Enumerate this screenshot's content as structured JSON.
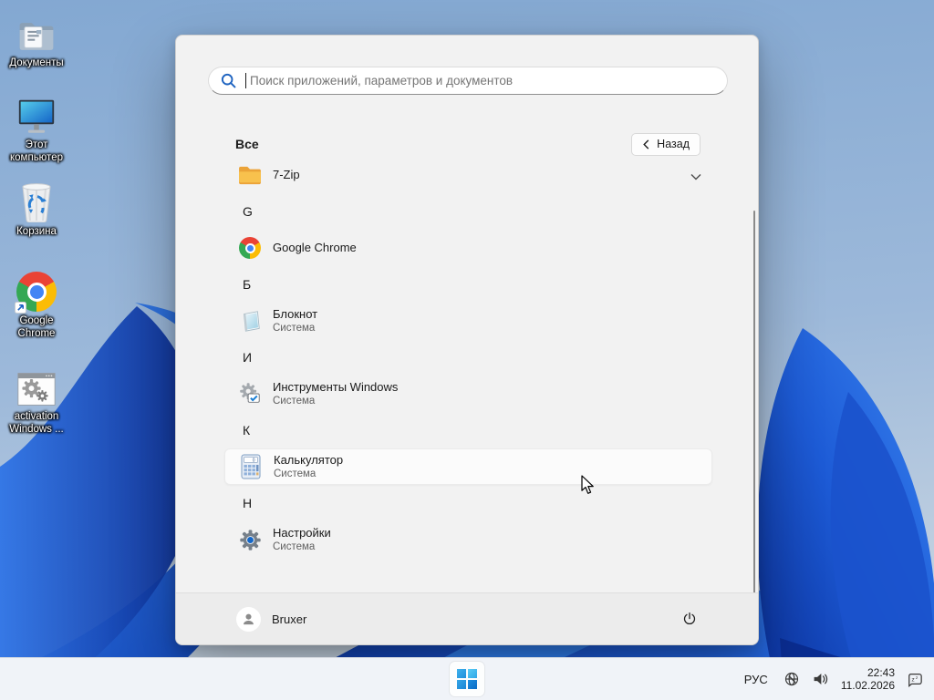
{
  "desktop": {
    "icons": [
      {
        "name": "documents",
        "label": "Документы"
      },
      {
        "name": "this-pc",
        "label": "Этот компьютер"
      },
      {
        "name": "recycle-bin",
        "label": "Корзина"
      },
      {
        "name": "google-chrome",
        "label": "Google Chrome"
      },
      {
        "name": "activation-windows",
        "label": "activation Windows ..."
      }
    ]
  },
  "start_menu": {
    "search": {
      "placeholder": "Поиск приложений, параметров и документов"
    },
    "header": {
      "title": "Все",
      "back_label": "Назад"
    },
    "rows": [
      {
        "type": "app",
        "label": "7-Zip",
        "expandable": true
      },
      {
        "type": "section",
        "label": "G"
      },
      {
        "type": "app",
        "label": "Google Chrome"
      },
      {
        "type": "section",
        "label": "Б"
      },
      {
        "type": "app",
        "label": "Блокнот",
        "sublabel": "Система"
      },
      {
        "type": "section",
        "label": "И"
      },
      {
        "type": "app",
        "label": "Инструменты Windows",
        "sublabel": "Система"
      },
      {
        "type": "section",
        "label": "К"
      },
      {
        "type": "app",
        "label": "Калькулятор",
        "sublabel": "Система",
        "highlighted": true
      },
      {
        "type": "section",
        "label": "Н"
      },
      {
        "type": "app",
        "label": "Настройки",
        "sublabel": "Система"
      }
    ],
    "footer": {
      "user_name": "Bruxer"
    }
  },
  "taskbar": {
    "language_indicator": "РУС",
    "clock": {
      "time": "22:43",
      "date": "11.02.2026"
    }
  },
  "icons": {
    "search-icon": "magnifying glass, blue",
    "back-chevron-icon": "‹",
    "chevron-down-icon": "⌄",
    "power-icon": "⏻",
    "user-avatar-icon": "person silhouette",
    "windows-start-icon": "four blue squares",
    "globe-offline-icon": "globe with slash",
    "speaker-icon": "volume",
    "dnd-notification-icon": "bell with zz"
  },
  "colors": {
    "accent_blue": "#0b6cc6",
    "petal_bright": "#3b86f0",
    "petal_deep": "#082a92",
    "menu_bg": "#f2f2f2",
    "taskbar_bg": "#f0f3f8",
    "highlight_row": "#fbfbfb"
  }
}
